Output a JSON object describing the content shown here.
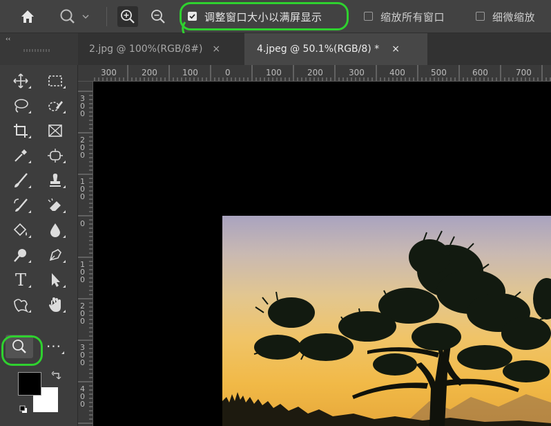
{
  "options_bar": {
    "resize_windows_label": "调整窗口大小以满屏显示",
    "resize_windows_checked": true,
    "zoom_all_label": "缩放所有窗口",
    "zoom_all_checked": false,
    "scrubby_zoom_label": "细微缩放",
    "scrubby_zoom_checked": false,
    "icons": [
      "home-icon",
      "zoom-preset-icon",
      "zoom-in-icon",
      "zoom-out-icon"
    ]
  },
  "tabs": [
    {
      "label": "2.jpg @ 100%(RGB/8#)",
      "close": "×",
      "active": false
    },
    {
      "label": "4.jpeg @ 50.1%(RGB/8) *",
      "close": "×",
      "active": true
    }
  ],
  "ruler": {
    "horizontal": [
      "300",
      "200",
      "100",
      "0",
      "100",
      "200",
      "300",
      "400",
      "500",
      "600",
      "700"
    ],
    "vertical": [
      "3\n0\n0",
      "2\n0\n0",
      "1\n0\n0",
      "0",
      "1\n0\n0",
      "2\n0\n0",
      "3\n0\n0",
      "4\n0\n0"
    ]
  },
  "toolbar": {
    "collapse_glyph": "‹‹",
    "tools": [
      "move-tool",
      "marquee-tool",
      "lasso-tool",
      "quick-select-tool",
      "crop-tool",
      "frame-tool",
      "eyedropper-tool",
      "spot-healing-tool",
      "brush-tool",
      "clone-stamp-tool",
      "history-brush-tool",
      "eraser-tool",
      "paint-bucket-tool",
      "blur-tool",
      "dodge-tool",
      "pen-tool",
      "type-tool",
      "path-select-tool",
      "shape-tool",
      "hand-tool",
      "zoom-tool",
      "more-tools"
    ],
    "text_tool_glyph": "T",
    "more_glyph": "···",
    "foreground_color": "#000000",
    "background_color": "#ffffff"
  },
  "colors": {
    "highlight": "#2fd12f",
    "panel": "#3d3d3d",
    "canvas": "#000000"
  }
}
